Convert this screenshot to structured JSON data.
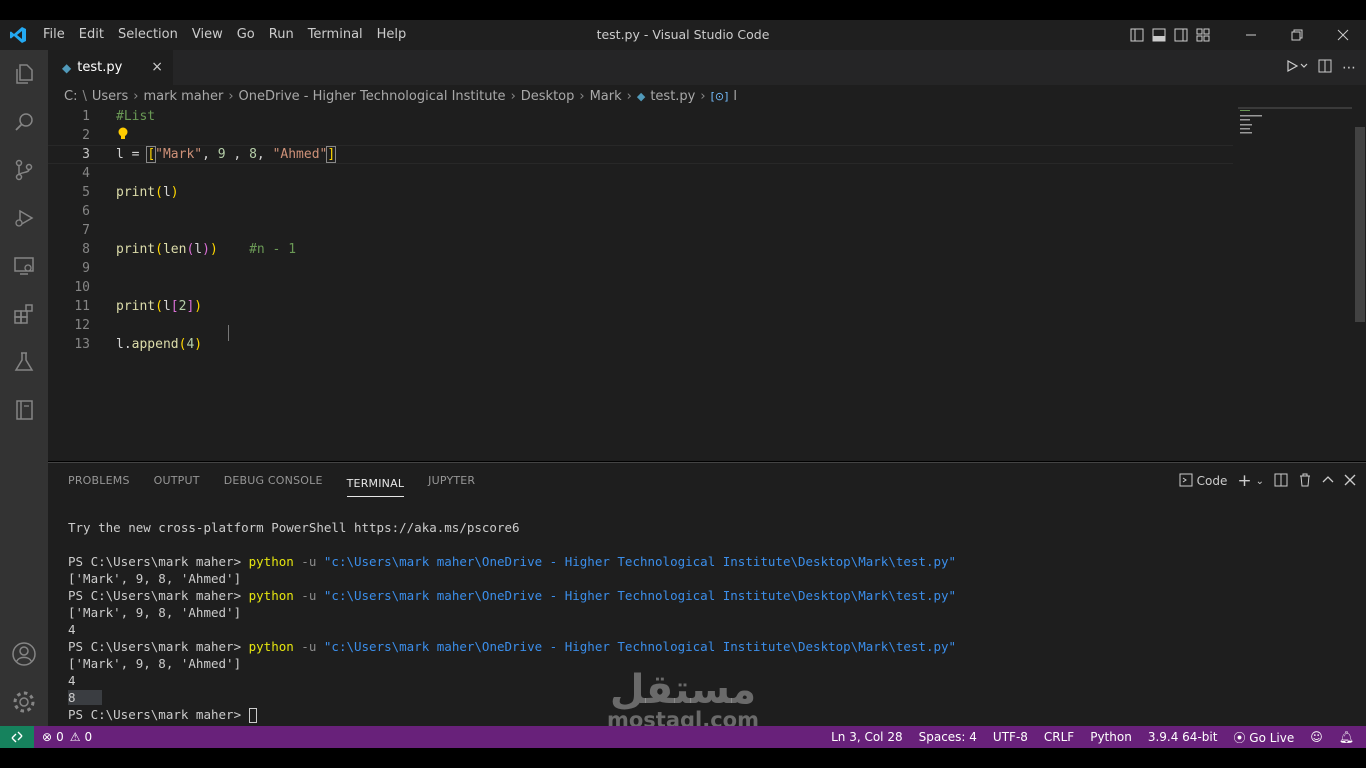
{
  "window": {
    "title": "test.py - Visual Studio Code",
    "menu": [
      "File",
      "Edit",
      "Selection",
      "View",
      "Go",
      "Run",
      "Terminal",
      "Help"
    ]
  },
  "tab": {
    "label": "test.py",
    "close": "×"
  },
  "breadcrumb": [
    "C:",
    "Users",
    "mark maher",
    "OneDrive - Higher Technological Institute",
    "Desktop",
    "Mark",
    "test.py",
    "l"
  ],
  "editor": {
    "line_numbers": [
      "1",
      "2",
      "3",
      "4",
      "5",
      "6",
      "7",
      "8",
      "9",
      "10",
      "11",
      "12",
      "13"
    ],
    "current_line": "3",
    "lines": {
      "l1_comment": "#List",
      "l3_var": "l",
      "l3_eq": " = ",
      "l3_open": "[",
      "l3_s1": "\"Mark\"",
      "l3_mid": ", 9 , 8, ",
      "l3_n1": "9",
      "l3_n2": "8",
      "l3_s2": "\"Ahmed\"",
      "l3_close": "]",
      "l5_fn": "print",
      "l5_arg": "l",
      "l8_fn": "print",
      "l8_fn2": "len",
      "l8_arg": "l",
      "l8_comment": "#n - 1",
      "l11_fn": "print",
      "l11_arg": "l",
      "l11_idx": "2",
      "l13_obj": "l",
      "l13_method": "append",
      "l13_num": "4"
    }
  },
  "panel": {
    "tabs": [
      "PROBLEMS",
      "OUTPUT",
      "DEBUG CONSOLE",
      "TERMINAL",
      "JUPYTER"
    ],
    "active_tab": "TERMINAL",
    "terminal_profile": "Code"
  },
  "terminal": {
    "intro": "Try the new cross-platform PowerShell https://aka.ms/pscore6",
    "prompt": "PS C:\\Users\\mark maher> ",
    "cmd": "python",
    "flag": " -u ",
    "path": "\"c:\\Users\\mark maher\\OneDrive - Higher Technological Institute\\Desktop\\Mark\\test.py\"",
    "out_list": "['Mark', 9, 8, 'Ahmed']",
    "out_4": "4",
    "out_8": "8"
  },
  "watermark": {
    "arabic": "مستقل",
    "latin": "mostaql.com"
  },
  "statusbar": {
    "errors": "0",
    "warnings": "0",
    "position": "Ln 3, Col 28",
    "spaces": "Spaces: 4",
    "encoding": "UTF-8",
    "eol": "CRLF",
    "language": "Python",
    "interpreter": "3.9.4 64-bit",
    "go_live": "Go Live"
  },
  "colors": {
    "statusbar": "#68217a",
    "remote": "#16825d",
    "activitybar": "#333333",
    "editor_bg": "#1e1e1e"
  }
}
